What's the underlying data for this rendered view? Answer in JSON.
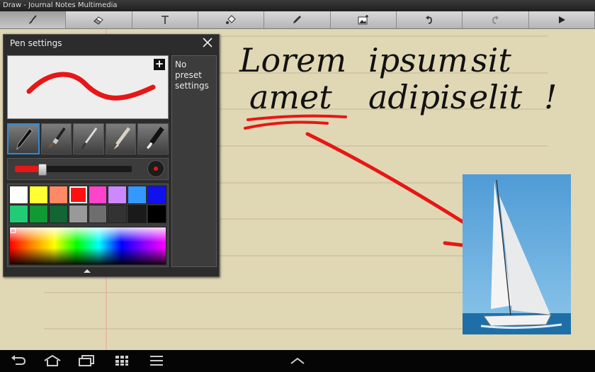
{
  "window": {
    "title": "Draw - Journal Notes Multimedia"
  },
  "toolbar": {
    "items": [
      {
        "name": "brush-tool",
        "icon": "brush-icon",
        "active": true
      },
      {
        "name": "eraser-tool",
        "icon": "eraser-icon",
        "active": false
      },
      {
        "name": "text-tool",
        "icon": "text-icon",
        "label": "T",
        "active": false
      },
      {
        "name": "fill-tool",
        "icon": "paint-bucket-icon",
        "active": false
      },
      {
        "name": "eyedropper-tool",
        "icon": "eyedropper-icon",
        "active": false
      },
      {
        "name": "insert-image-tool",
        "icon": "add-image-icon",
        "active": false
      },
      {
        "name": "undo-tool",
        "icon": "undo-icon",
        "active": false
      },
      {
        "name": "redo-tool",
        "icon": "redo-icon",
        "active": false
      },
      {
        "name": "play-tool",
        "icon": "play-icon",
        "active": false
      }
    ]
  },
  "pen_settings": {
    "title": "Pen settings",
    "presets_text": "No preset settings",
    "brushes": [
      "fountain-pen-icon",
      "paint-brush-icon",
      "fine-brush-icon",
      "pencil-icon",
      "marker-icon"
    ],
    "selected_brush_index": 0,
    "size_level": 0.2,
    "colors": [
      "#ffffff",
      "#ffff33",
      "#ff8866",
      "#ff1111",
      "#ff44cc",
      "#cc88ff",
      "#3399ff",
      "#1111ee",
      "#22cc77",
      "#119933",
      "#116633",
      "#999999",
      "#6e6e6e",
      "#333333",
      "#1a1a1a",
      "#000000"
    ],
    "selected_color_index": 3,
    "current_color": "#e81616"
  },
  "canvas": {
    "paper_color": "#e0d7b4",
    "handwriting_line1": [
      "Lorem",
      "ipsum",
      "sit"
    ],
    "handwriting_line2": [
      "amet",
      "adipis",
      "elit",
      "!"
    ],
    "photo": "sailboat"
  },
  "navbar": {
    "buttons": [
      "back-icon",
      "home-icon",
      "recent-apps-icon",
      "grid-icon",
      "menu-icon",
      "chevron-up-icon"
    ]
  }
}
